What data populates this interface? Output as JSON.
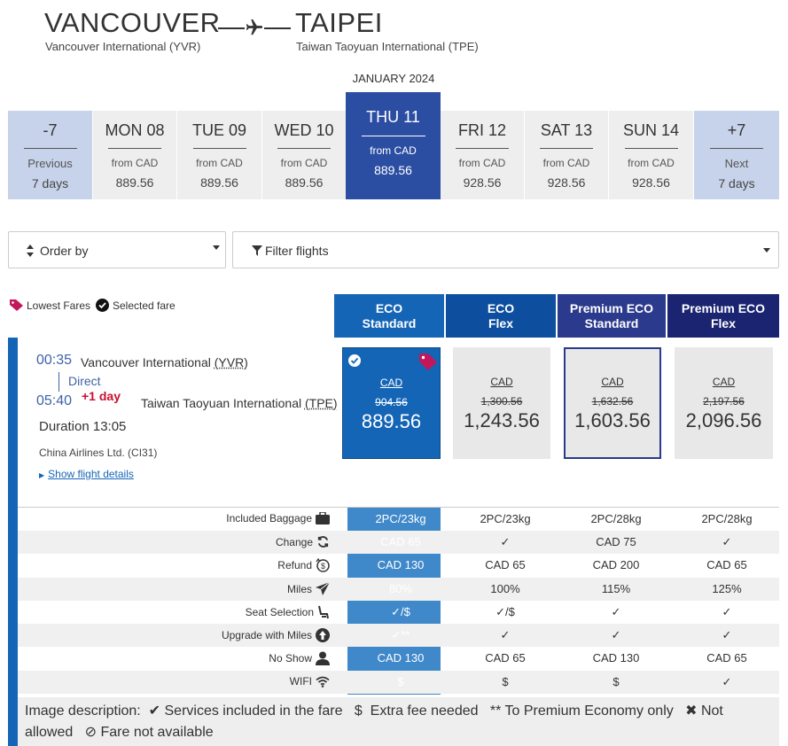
{
  "route": {
    "origin_city": "VANCOUVER",
    "origin_airport": "Vancouver International (YVR)",
    "dest_city": "TAIPEI",
    "dest_airport": "Taiwan Taoyuan International (TPE)"
  },
  "month": "JANUARY 2024",
  "dates": {
    "prev": {
      "top": "-7",
      "line1": "Previous",
      "line2": "7 days"
    },
    "days": [
      {
        "day": "MON 08",
        "from": "from CAD",
        "price": "889.56"
      },
      {
        "day": "TUE 09",
        "from": "from CAD",
        "price": "889.56"
      },
      {
        "day": "WED 10",
        "from": "from CAD",
        "price": "889.56"
      },
      {
        "day": "THU 11",
        "from": "from CAD",
        "price": "889.56"
      },
      {
        "day": "FRI 12",
        "from": "from CAD",
        "price": "928.56"
      },
      {
        "day": "SAT 13",
        "from": "from CAD",
        "price": "928.56"
      },
      {
        "day": "SUN 14",
        "from": "from CAD",
        "price": "928.56"
      }
    ],
    "next": {
      "top": "+7",
      "line1": "Next",
      "line2": "7 days"
    }
  },
  "controls": {
    "order_by": "Order by",
    "filter": "Filter flights"
  },
  "legend": {
    "lowest": "Lowest Fares",
    "selected": "Selected fare"
  },
  "fare_headers": [
    {
      "line1": "ECO",
      "line2": "Standard",
      "color": "#1565b7"
    },
    {
      "line1": "ECO",
      "line2": "Flex",
      "color": "#0d4f9e"
    },
    {
      "line1": "Premium ECO",
      "line2": "Standard",
      "color": "#2b3a8c"
    },
    {
      "line1": "Premium ECO",
      "line2": "Flex",
      "color": "#1a2470"
    }
  ],
  "flight": {
    "dep_time": "00:35",
    "dep_airport_name": "Vancouver International",
    "dep_code": "(YVR)",
    "stops": "Direct",
    "arr_time": "05:40",
    "plus_day": "+1 day",
    "arr_airport_name": "Taiwan Taoyuan International",
    "arr_code": "(TPE)",
    "duration": "Duration 13:05",
    "carrier": "China Airlines Ltd. (CI31)",
    "details_link": "Show flight details"
  },
  "fares": [
    {
      "cur": "CAD",
      "old": "904.56",
      "new": "889.56"
    },
    {
      "cur": "CAD",
      "old": "1,300.56",
      "new": "1,243.56"
    },
    {
      "cur": "CAD",
      "old": "1,632.56",
      "new": "1,603.56"
    },
    {
      "cur": "CAD",
      "old": "2,197.56",
      "new": "2,096.56"
    }
  ],
  "table": [
    {
      "label": "Included Baggage",
      "icon": "suitcase-icon",
      "vals": [
        "2PC/23kg",
        "2PC/23kg",
        "2PC/28kg",
        "2PC/28kg"
      ]
    },
    {
      "label": "Change",
      "icon": "change-icon",
      "vals": [
        "CAD 65",
        "✓",
        "CAD 75",
        "✓"
      ]
    },
    {
      "label": "Refund",
      "icon": "refund-icon",
      "vals": [
        "CAD 130",
        "CAD 65",
        "CAD 200",
        "CAD 65"
      ]
    },
    {
      "label": "Miles",
      "icon": "paper-plane-icon",
      "vals": [
        "80%",
        "100%",
        "115%",
        "125%"
      ]
    },
    {
      "label": "Seat Selection",
      "icon": "seat-icon",
      "vals": [
        "✓/$",
        "✓/$",
        "✓",
        "✓"
      ]
    },
    {
      "label": "Upgrade with Miles",
      "icon": "upgrade-icon",
      "vals": [
        "✓**",
        "✓",
        "✓",
        "✓"
      ]
    },
    {
      "label": "No Show",
      "icon": "person-icon",
      "vals": [
        "CAD 130",
        "CAD 65",
        "CAD 130",
        "CAD 65"
      ]
    },
    {
      "label": "WIFI",
      "icon": "wifi-icon",
      "vals": [
        "$",
        "$",
        "$",
        "✓"
      ]
    }
  ],
  "footer": {
    "prefix": "Image description:",
    "included": "Services included in the fare",
    "fee_sym": "$",
    "fee": "Extra fee needed",
    "premium_sym": "**",
    "premium": "To Premium Economy only",
    "not_allowed": "Not allowed",
    "unavailable": "Fare not available"
  }
}
